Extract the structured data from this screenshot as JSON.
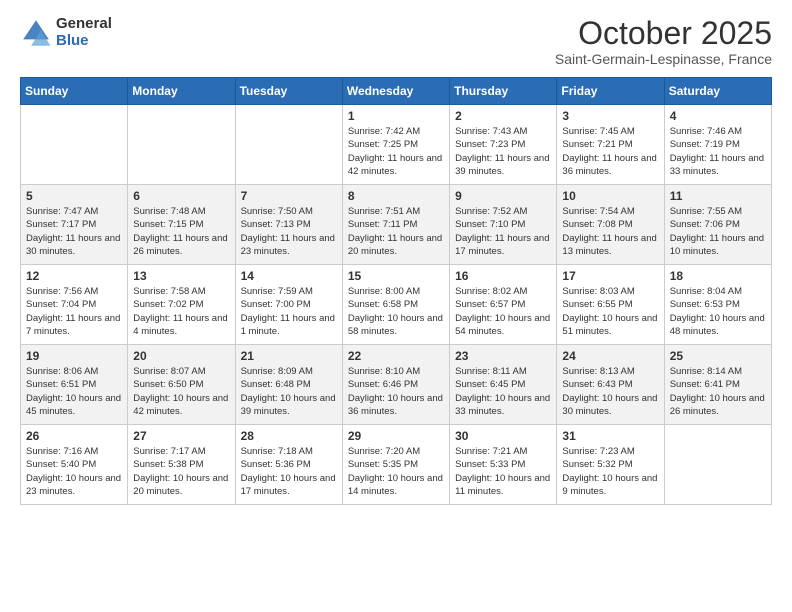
{
  "logo": {
    "general": "General",
    "blue": "Blue"
  },
  "header": {
    "month": "October 2025",
    "location": "Saint-Germain-Lespinasse, France"
  },
  "weekdays": [
    "Sunday",
    "Monday",
    "Tuesday",
    "Wednesday",
    "Thursday",
    "Friday",
    "Saturday"
  ],
  "weeks": [
    [
      {
        "day": "",
        "sunrise": "",
        "sunset": "",
        "daylight": ""
      },
      {
        "day": "",
        "sunrise": "",
        "sunset": "",
        "daylight": ""
      },
      {
        "day": "",
        "sunrise": "",
        "sunset": "",
        "daylight": ""
      },
      {
        "day": "1",
        "sunrise": "Sunrise: 7:42 AM",
        "sunset": "Sunset: 7:25 PM",
        "daylight": "Daylight: 11 hours and 42 minutes."
      },
      {
        "day": "2",
        "sunrise": "Sunrise: 7:43 AM",
        "sunset": "Sunset: 7:23 PM",
        "daylight": "Daylight: 11 hours and 39 minutes."
      },
      {
        "day": "3",
        "sunrise": "Sunrise: 7:45 AM",
        "sunset": "Sunset: 7:21 PM",
        "daylight": "Daylight: 11 hours and 36 minutes."
      },
      {
        "day": "4",
        "sunrise": "Sunrise: 7:46 AM",
        "sunset": "Sunset: 7:19 PM",
        "daylight": "Daylight: 11 hours and 33 minutes."
      }
    ],
    [
      {
        "day": "5",
        "sunrise": "Sunrise: 7:47 AM",
        "sunset": "Sunset: 7:17 PM",
        "daylight": "Daylight: 11 hours and 30 minutes."
      },
      {
        "day": "6",
        "sunrise": "Sunrise: 7:48 AM",
        "sunset": "Sunset: 7:15 PM",
        "daylight": "Daylight: 11 hours and 26 minutes."
      },
      {
        "day": "7",
        "sunrise": "Sunrise: 7:50 AM",
        "sunset": "Sunset: 7:13 PM",
        "daylight": "Daylight: 11 hours and 23 minutes."
      },
      {
        "day": "8",
        "sunrise": "Sunrise: 7:51 AM",
        "sunset": "Sunset: 7:11 PM",
        "daylight": "Daylight: 11 hours and 20 minutes."
      },
      {
        "day": "9",
        "sunrise": "Sunrise: 7:52 AM",
        "sunset": "Sunset: 7:10 PM",
        "daylight": "Daylight: 11 hours and 17 minutes."
      },
      {
        "day": "10",
        "sunrise": "Sunrise: 7:54 AM",
        "sunset": "Sunset: 7:08 PM",
        "daylight": "Daylight: 11 hours and 13 minutes."
      },
      {
        "day": "11",
        "sunrise": "Sunrise: 7:55 AM",
        "sunset": "Sunset: 7:06 PM",
        "daylight": "Daylight: 11 hours and 10 minutes."
      }
    ],
    [
      {
        "day": "12",
        "sunrise": "Sunrise: 7:56 AM",
        "sunset": "Sunset: 7:04 PM",
        "daylight": "Daylight: 11 hours and 7 minutes."
      },
      {
        "day": "13",
        "sunrise": "Sunrise: 7:58 AM",
        "sunset": "Sunset: 7:02 PM",
        "daylight": "Daylight: 11 hours and 4 minutes."
      },
      {
        "day": "14",
        "sunrise": "Sunrise: 7:59 AM",
        "sunset": "Sunset: 7:00 PM",
        "daylight": "Daylight: 11 hours and 1 minute."
      },
      {
        "day": "15",
        "sunrise": "Sunrise: 8:00 AM",
        "sunset": "Sunset: 6:58 PM",
        "daylight": "Daylight: 10 hours and 58 minutes."
      },
      {
        "day": "16",
        "sunrise": "Sunrise: 8:02 AM",
        "sunset": "Sunset: 6:57 PM",
        "daylight": "Daylight: 10 hours and 54 minutes."
      },
      {
        "day": "17",
        "sunrise": "Sunrise: 8:03 AM",
        "sunset": "Sunset: 6:55 PM",
        "daylight": "Daylight: 10 hours and 51 minutes."
      },
      {
        "day": "18",
        "sunrise": "Sunrise: 8:04 AM",
        "sunset": "Sunset: 6:53 PM",
        "daylight": "Daylight: 10 hours and 48 minutes."
      }
    ],
    [
      {
        "day": "19",
        "sunrise": "Sunrise: 8:06 AM",
        "sunset": "Sunset: 6:51 PM",
        "daylight": "Daylight: 10 hours and 45 minutes."
      },
      {
        "day": "20",
        "sunrise": "Sunrise: 8:07 AM",
        "sunset": "Sunset: 6:50 PM",
        "daylight": "Daylight: 10 hours and 42 minutes."
      },
      {
        "day": "21",
        "sunrise": "Sunrise: 8:09 AM",
        "sunset": "Sunset: 6:48 PM",
        "daylight": "Daylight: 10 hours and 39 minutes."
      },
      {
        "day": "22",
        "sunrise": "Sunrise: 8:10 AM",
        "sunset": "Sunset: 6:46 PM",
        "daylight": "Daylight: 10 hours and 36 minutes."
      },
      {
        "day": "23",
        "sunrise": "Sunrise: 8:11 AM",
        "sunset": "Sunset: 6:45 PM",
        "daylight": "Daylight: 10 hours and 33 minutes."
      },
      {
        "day": "24",
        "sunrise": "Sunrise: 8:13 AM",
        "sunset": "Sunset: 6:43 PM",
        "daylight": "Daylight: 10 hours and 30 minutes."
      },
      {
        "day": "25",
        "sunrise": "Sunrise: 8:14 AM",
        "sunset": "Sunset: 6:41 PM",
        "daylight": "Daylight: 10 hours and 26 minutes."
      }
    ],
    [
      {
        "day": "26",
        "sunrise": "Sunrise: 7:16 AM",
        "sunset": "Sunset: 5:40 PM",
        "daylight": "Daylight: 10 hours and 23 minutes."
      },
      {
        "day": "27",
        "sunrise": "Sunrise: 7:17 AM",
        "sunset": "Sunset: 5:38 PM",
        "daylight": "Daylight: 10 hours and 20 minutes."
      },
      {
        "day": "28",
        "sunrise": "Sunrise: 7:18 AM",
        "sunset": "Sunset: 5:36 PM",
        "daylight": "Daylight: 10 hours and 17 minutes."
      },
      {
        "day": "29",
        "sunrise": "Sunrise: 7:20 AM",
        "sunset": "Sunset: 5:35 PM",
        "daylight": "Daylight: 10 hours and 14 minutes."
      },
      {
        "day": "30",
        "sunrise": "Sunrise: 7:21 AM",
        "sunset": "Sunset: 5:33 PM",
        "daylight": "Daylight: 10 hours and 11 minutes."
      },
      {
        "day": "31",
        "sunrise": "Sunrise: 7:23 AM",
        "sunset": "Sunset: 5:32 PM",
        "daylight": "Daylight: 10 hours and 9 minutes."
      },
      {
        "day": "",
        "sunrise": "",
        "sunset": "",
        "daylight": ""
      }
    ]
  ]
}
